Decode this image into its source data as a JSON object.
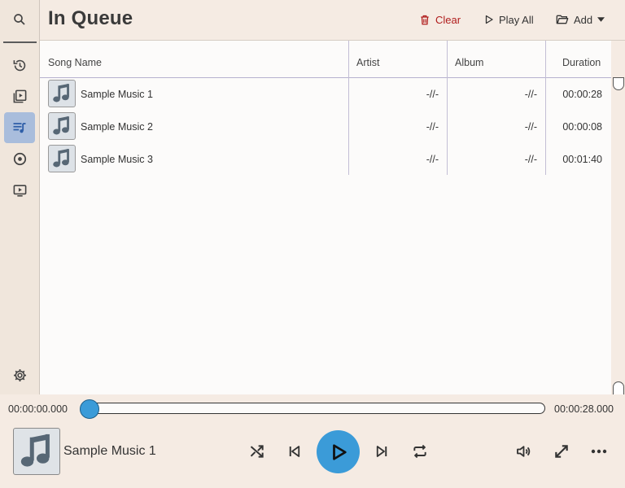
{
  "page": {
    "title": "In Queue"
  },
  "header": {
    "clear_label": "Clear",
    "play_all_label": "Play All",
    "add_label": "Add",
    "clear_color": "#b01c1c"
  },
  "sidebar": {
    "items": [
      {
        "icon": "search-icon"
      },
      {
        "icon": "history-icon"
      },
      {
        "icon": "video-library-icon"
      },
      {
        "icon": "queue-music-icon",
        "active": true
      },
      {
        "icon": "disc-icon"
      },
      {
        "icon": "screen-play-icon"
      },
      {
        "icon": "gear-icon"
      }
    ]
  },
  "table": {
    "columns": [
      "Song Name",
      "Artist",
      "Album",
      "Duration"
    ],
    "rows": [
      {
        "name": "Sample Music 1",
        "artist": "-//-",
        "album": "-//-",
        "duration": "00:00:28"
      },
      {
        "name": "Sample Music 2",
        "artist": "-//-",
        "album": "-//-",
        "duration": "00:00:08"
      },
      {
        "name": "Sample Music 3",
        "artist": "-//-",
        "album": "-//-",
        "duration": "00:01:40"
      }
    ]
  },
  "player": {
    "current_time": "00:00:00.000",
    "total_time": "00:00:28.000",
    "progress": 0,
    "now_playing": "Sample Music 1",
    "accent": "#3b9bd8"
  }
}
